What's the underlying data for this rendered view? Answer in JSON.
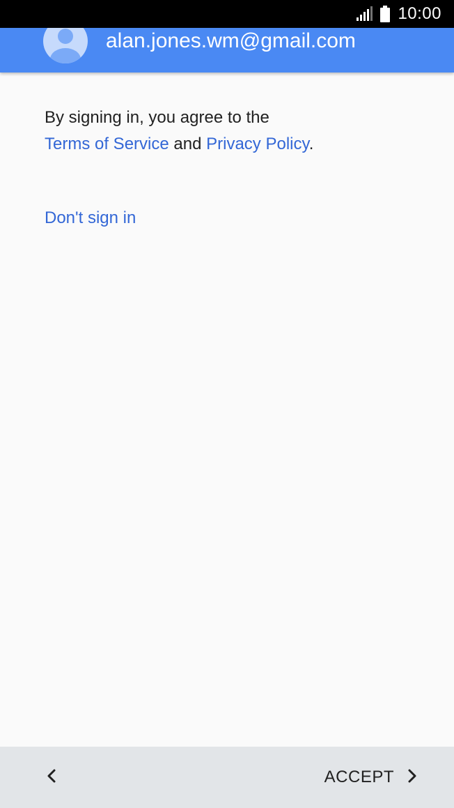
{
  "status_bar": {
    "time": "10:00",
    "signal_icon": "signal-icon",
    "battery_icon": "battery-icon"
  },
  "account": {
    "email": "alan.jones.wm@gmail.com",
    "avatar_icon": "avatar-icon"
  },
  "terms": {
    "line1": "By signing in, you agree to the",
    "terms_link": "Terms of Service",
    "and_text": " and ",
    "privacy_link": "Privacy Policy",
    "period": "."
  },
  "dont_sign_in": "Don't sign in",
  "bottom_bar": {
    "back_icon": "chevron-left-icon",
    "accept_label": "ACCEPT",
    "accept_icon": "chevron-right-icon"
  },
  "colors": {
    "header": "#4a89f3",
    "link": "#3367d6",
    "bottom_bar": "#e2e5e8",
    "background": "#fafafa"
  }
}
